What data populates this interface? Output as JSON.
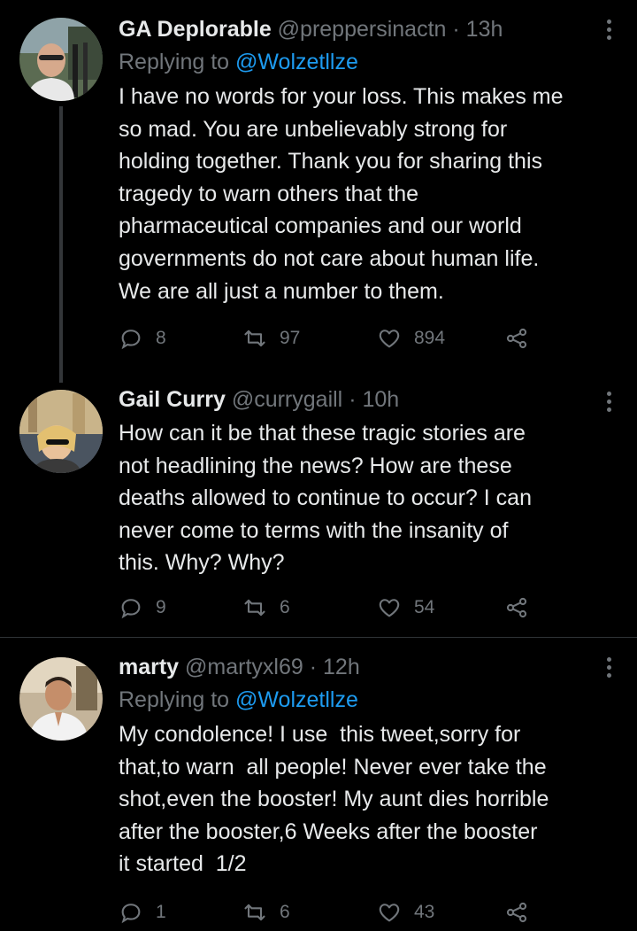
{
  "tweets": [
    {
      "name": "GA Deplorable",
      "handle": "@preppersinactn",
      "dot": "·",
      "time": "13h",
      "replying_prefix": "Replying to ",
      "replying_to": "@Wolzetllze",
      "text": "I have no words for your loss. This makes me\nso mad. You are unbelievably strong for\nholding together. Thank you for sharing this\ntragedy to warn others that the\npharmaceutical companies and our world\ngovernments do not care about human life.\nWe are all just a number to them.",
      "replies": "8",
      "retweets": "97",
      "likes": "894"
    },
    {
      "name": "Gail Curry",
      "handle": "@currygaill",
      "dot": "·",
      "time": "10h",
      "text": "How can it be that these tragic stories are\nnot headlining the news? How are these\ndeaths allowed to continue to occur? I can\nnever come to terms with the insanity of\nthis. Why? Why?",
      "replies": "9",
      "retweets": "6",
      "likes": "54"
    },
    {
      "name": "marty",
      "handle": "@martyxl69",
      "dot": "·",
      "time": "12h",
      "replying_prefix": "Replying to ",
      "replying_to": "@Wolzetllze",
      "text": "My condolence! I use  this tweet,sorry for\nthat,to warn  all people! Never ever take the\nshot,even the booster! My aunt dies horrible\nafter the booster,6 Weeks after the booster\nit started  1/2",
      "replies": "1",
      "retweets": "6",
      "likes": "43"
    }
  ],
  "icons": {
    "reply": "reply-icon",
    "retweet": "retweet-icon",
    "like": "heart-icon",
    "share": "share-icon",
    "more": "more-options-icon"
  },
  "colors": {
    "background": "#000000",
    "text": "#e7e9ea",
    "secondary": "#71767b",
    "link": "#1d9bf0"
  }
}
